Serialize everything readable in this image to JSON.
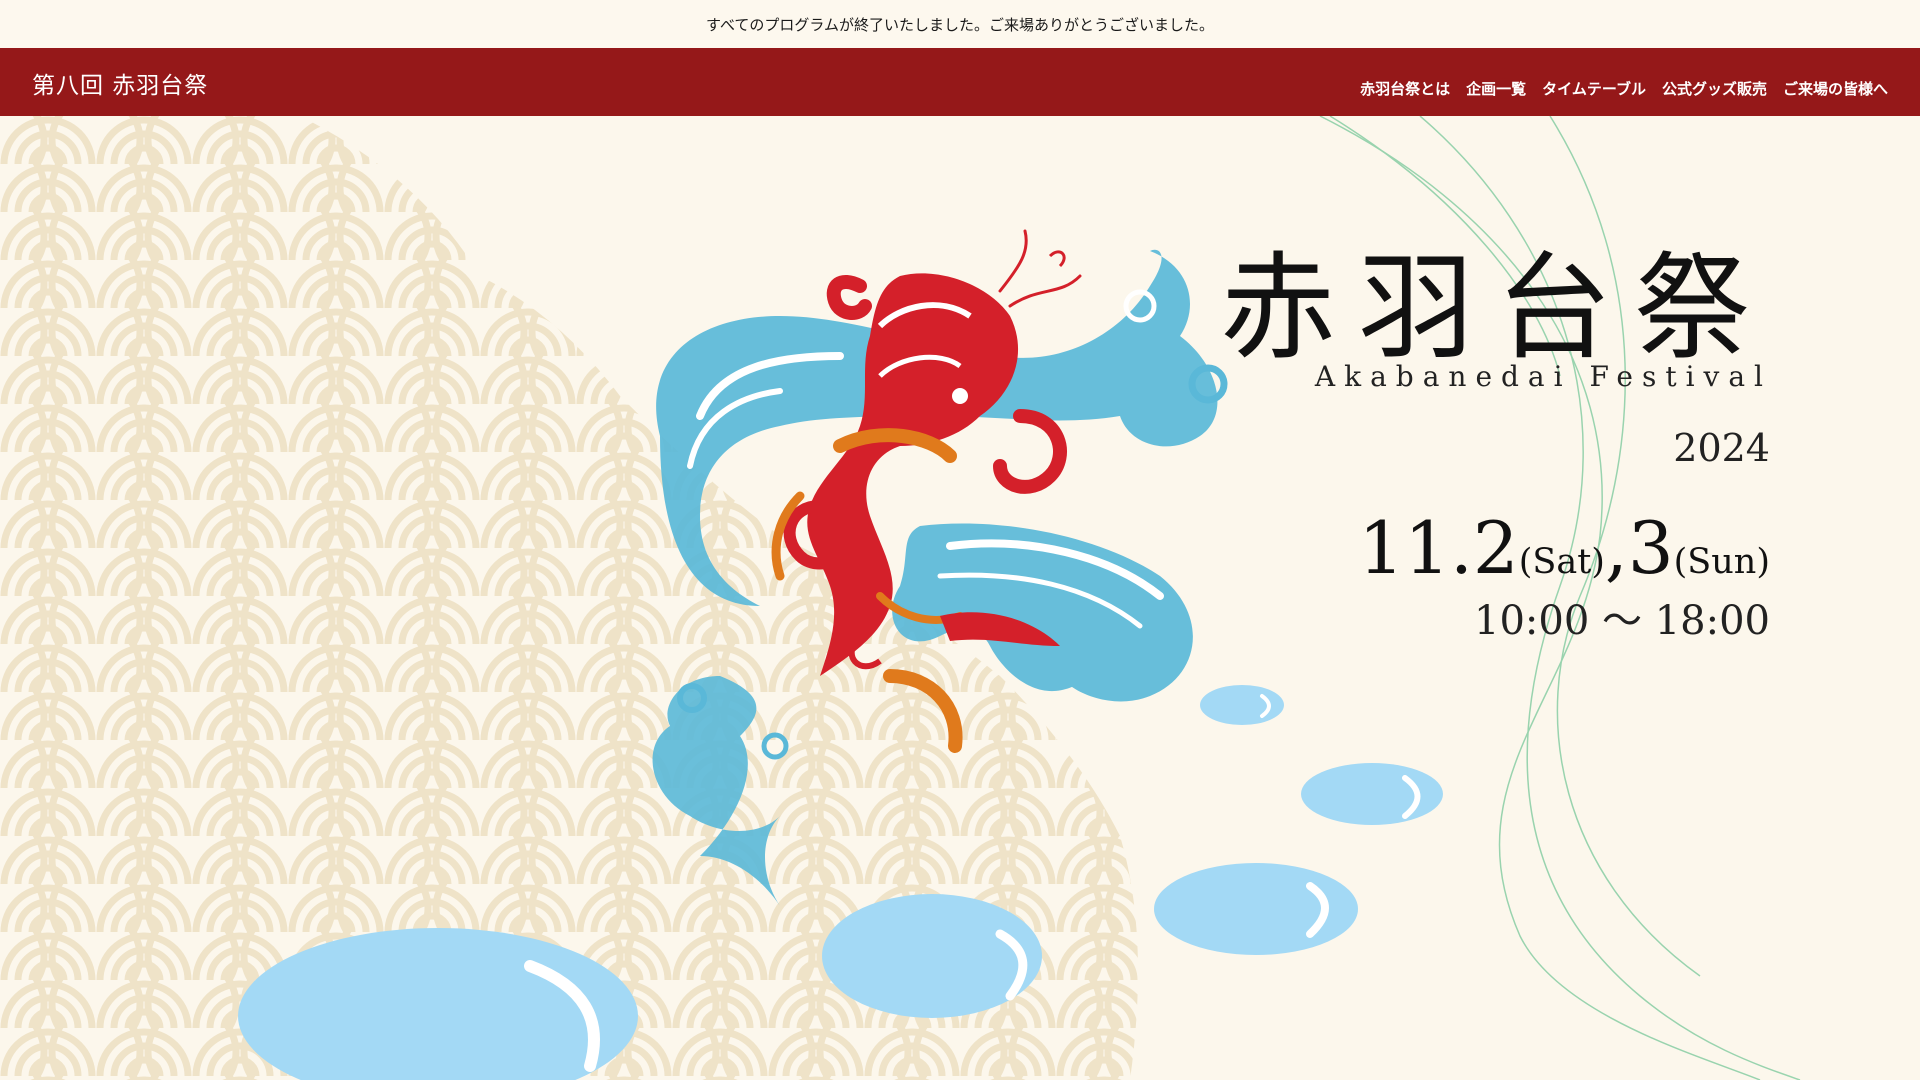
{
  "notice": "すべてのプログラムが終了いたしました。ご来場ありがとうございました。",
  "header": {
    "site_title": "第八回 赤羽台祭",
    "nav": [
      {
        "label": "赤羽台祭とは"
      },
      {
        "label": "企画一覧"
      },
      {
        "label": "タイムテーブル"
      },
      {
        "label": "公式グッズ販売"
      },
      {
        "label": "ご来場の皆様へ"
      }
    ]
  },
  "hero": {
    "title": "赤羽台祭",
    "subtitle": "Akabanedai Festival",
    "year": "2024",
    "date_day1": "11.2",
    "date_day1_dow": "(Sat)",
    "date_sep": ",",
    "date_day2": "3",
    "date_day2_dow": "(Sun)",
    "time": "10:00 ～ 18:00"
  },
  "colors": {
    "header_bg": "#951819",
    "page_bg": "#fcf7ec",
    "wave_pattern": "#efe3c8",
    "water_blue": "#a3d9f5",
    "wave_blue": "#5ab8d8",
    "fish_red": "#d4202a",
    "fish_orange": "#e07a1c",
    "accent_green": "#8fd0a8"
  },
  "icons": [
    "seigaiha-wave-pattern",
    "carp-fish-illustration",
    "water-drop-icon"
  ]
}
